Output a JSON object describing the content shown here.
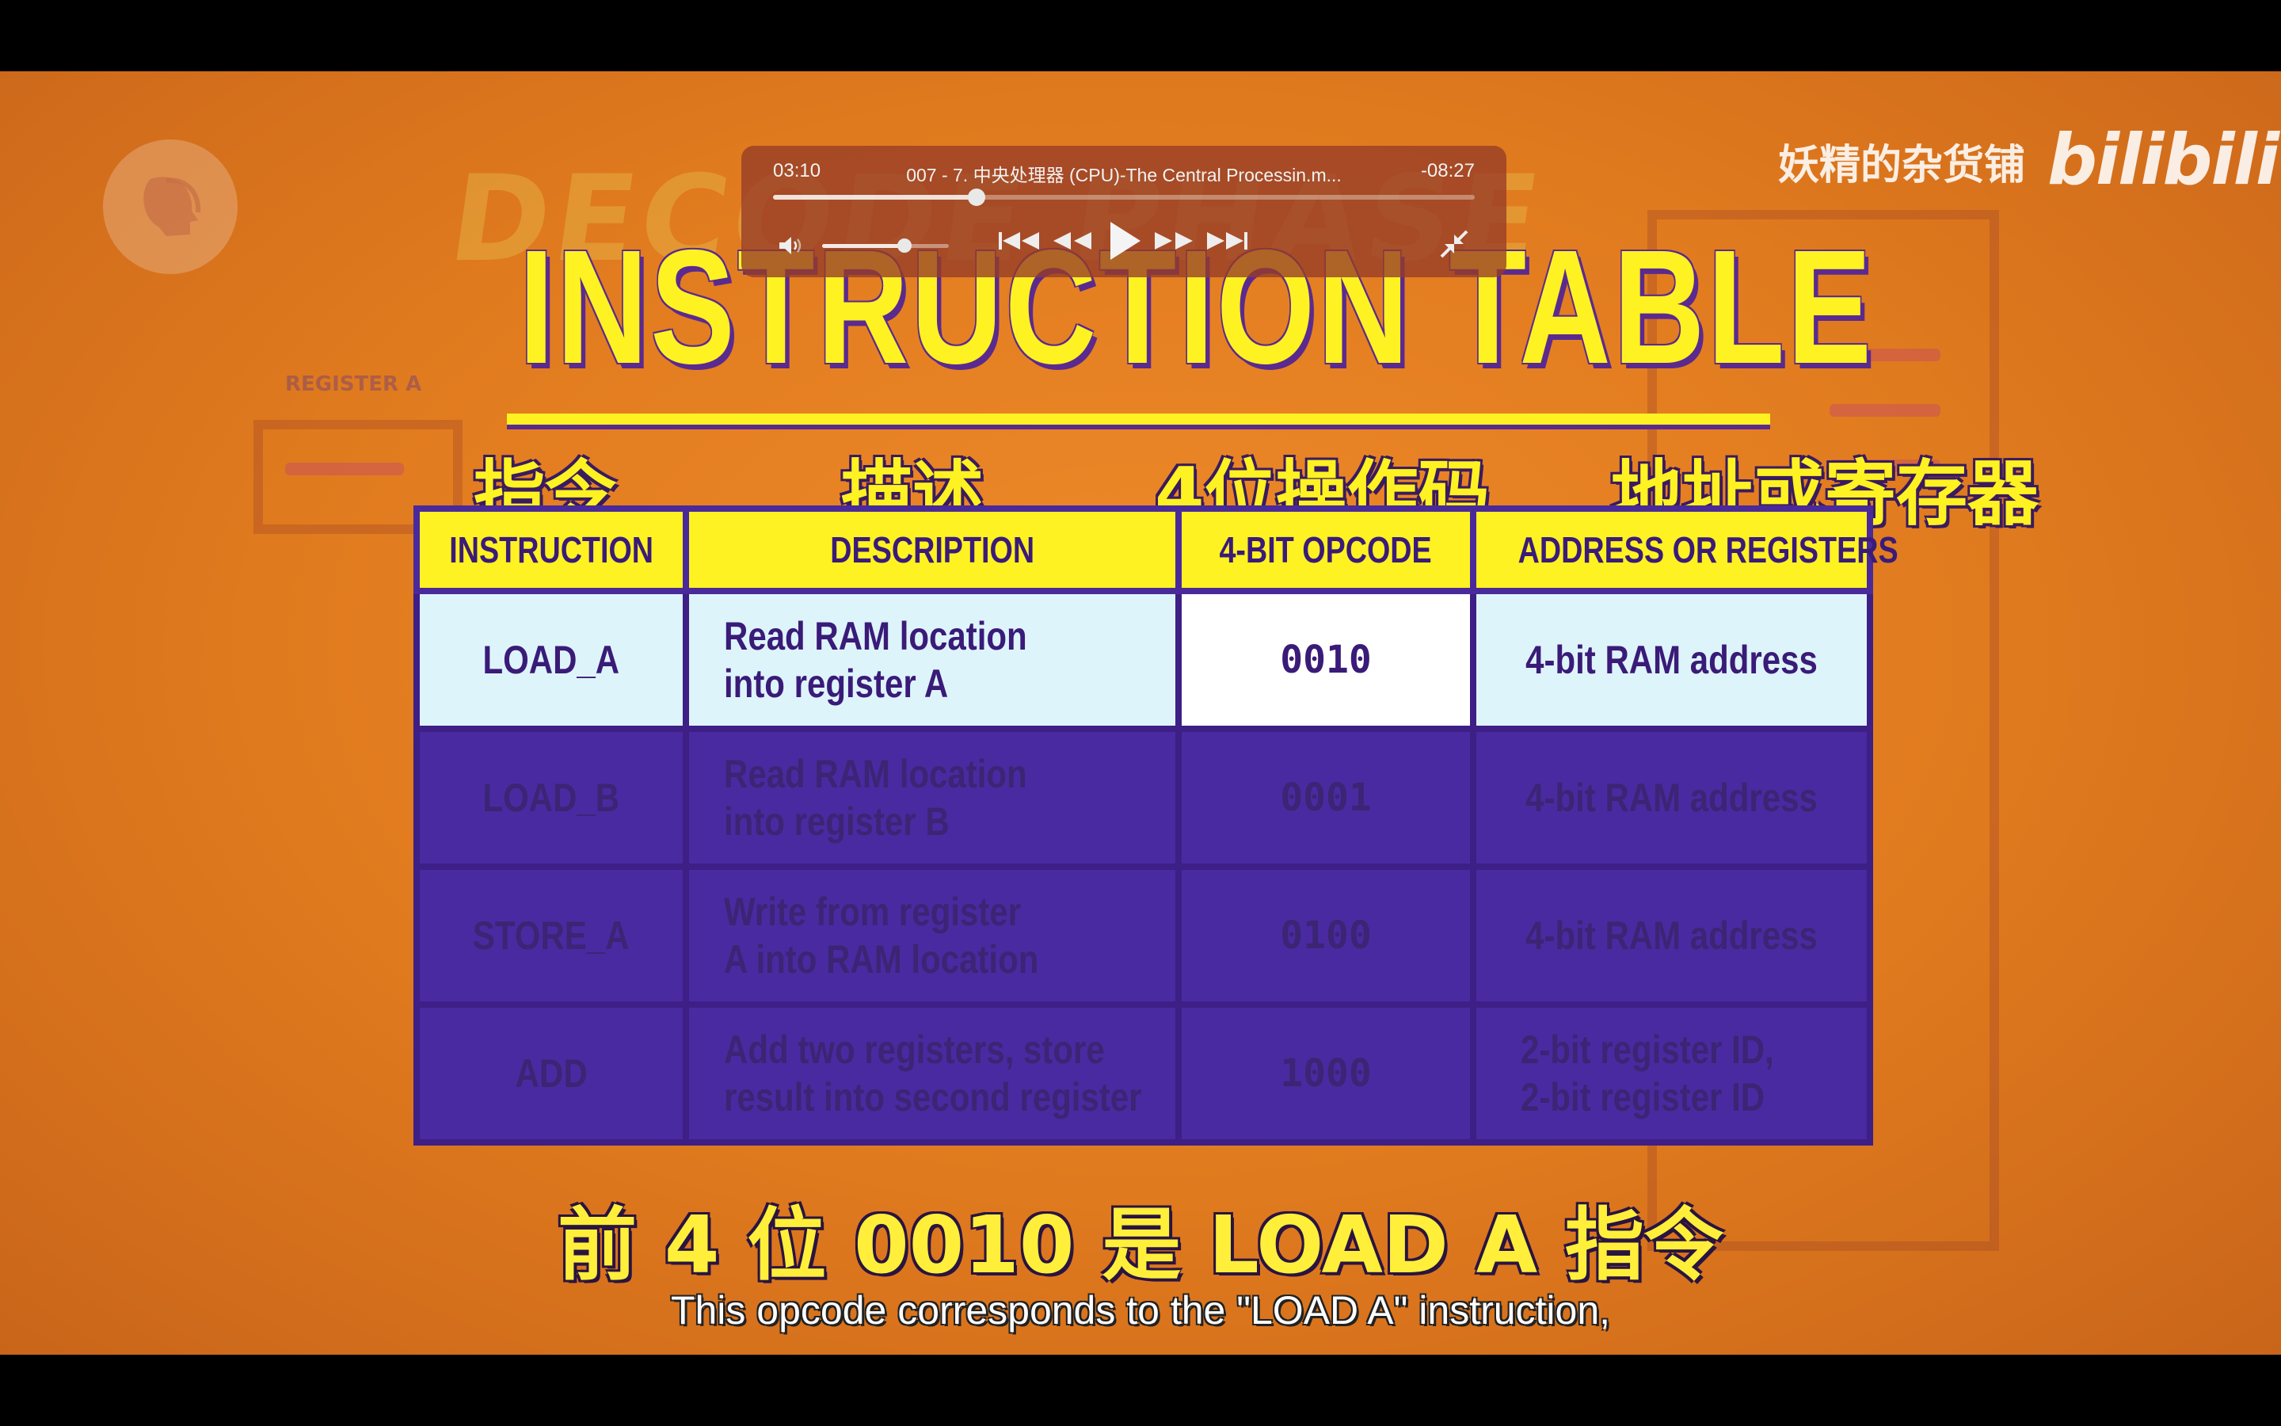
{
  "player": {
    "current_time": "03:10",
    "remaining_time": "-08:27",
    "title": "007 - 7. 中央处理器 (CPU)-The Central Processin.m...",
    "progress": 0.29,
    "volume": 0.65
  },
  "watermark": {
    "channel": "妖精的杂货铺",
    "brand": "bilibili"
  },
  "video": {
    "background_title": "DECODE PHASE",
    "background_register_label": "REGISTER A",
    "title": "INSTRUCTION TABLE",
    "zh_headers": [
      "指令",
      "描述",
      "4位操作码",
      "地址或寄存器"
    ],
    "table": {
      "headers": [
        "INSTRUCTION",
        "DESCRIPTION",
        "4-BIT OPCODE",
        "ADDRESS OR REGISTERS"
      ],
      "rows": [
        {
          "instruction": "LOAD_A",
          "desc1": "Read RAM location",
          "desc2": "into register A",
          "opcode": "0010",
          "address1": "4-bit RAM address",
          "address2": ""
        },
        {
          "instruction": "LOAD_B",
          "desc1": "Read RAM location",
          "desc2": "into register B",
          "opcode": "0001",
          "address1": "4-bit RAM address",
          "address2": ""
        },
        {
          "instruction": "STORE_A",
          "desc1": "Write from register",
          "desc2": "A into RAM location",
          "opcode": "0100",
          "address1": "4-bit RAM address",
          "address2": ""
        },
        {
          "instruction": "ADD",
          "desc1": "Add two registers, store",
          "desc2": "result into second register",
          "opcode": "1000",
          "address1": "2-bit register ID,",
          "address2": "2-bit register ID"
        }
      ]
    },
    "subtitle_zh": "前 4 位 0010 是 LOAD A 指令",
    "subtitle_en": "This opcode corresponds to the \"LOAD A\" instruction,"
  },
  "colors": {
    "background": "#e07a1e",
    "title_yellow": "#fff222",
    "table_purple": "#4a2aa0",
    "highlight_row": "#def4fb"
  }
}
